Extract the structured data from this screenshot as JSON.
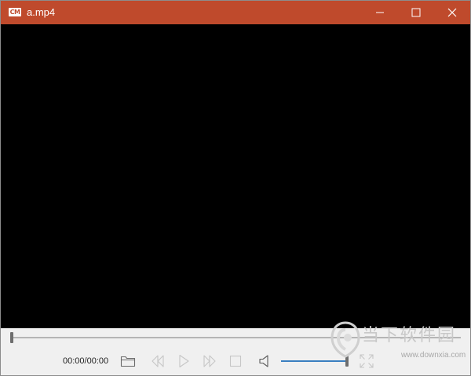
{
  "window": {
    "title": "a.mp4",
    "app_icon_label": "CM",
    "title_bar_color": "#bf4a2c"
  },
  "title_buttons": {
    "minimize_icon": "minimize-icon",
    "maximize_icon": "maximize-icon",
    "close_icon": "close-icon"
  },
  "video": {
    "background_color": "#000000"
  },
  "controls": {
    "time": "00:00/00:00",
    "seek_progress": 0,
    "volume_level": 1.0,
    "volume_color": "#3a7fc0",
    "icons": {
      "open": "folder-icon",
      "previous": "rewind-icon",
      "play": "play-icon",
      "next": "fast-forward-icon",
      "stop": "stop-icon",
      "volume": "speaker-icon",
      "fullscreen": "fullscreen-icon"
    }
  },
  "watermark": {
    "site_name": "当下软件园",
    "url": "www.downxia.com"
  }
}
